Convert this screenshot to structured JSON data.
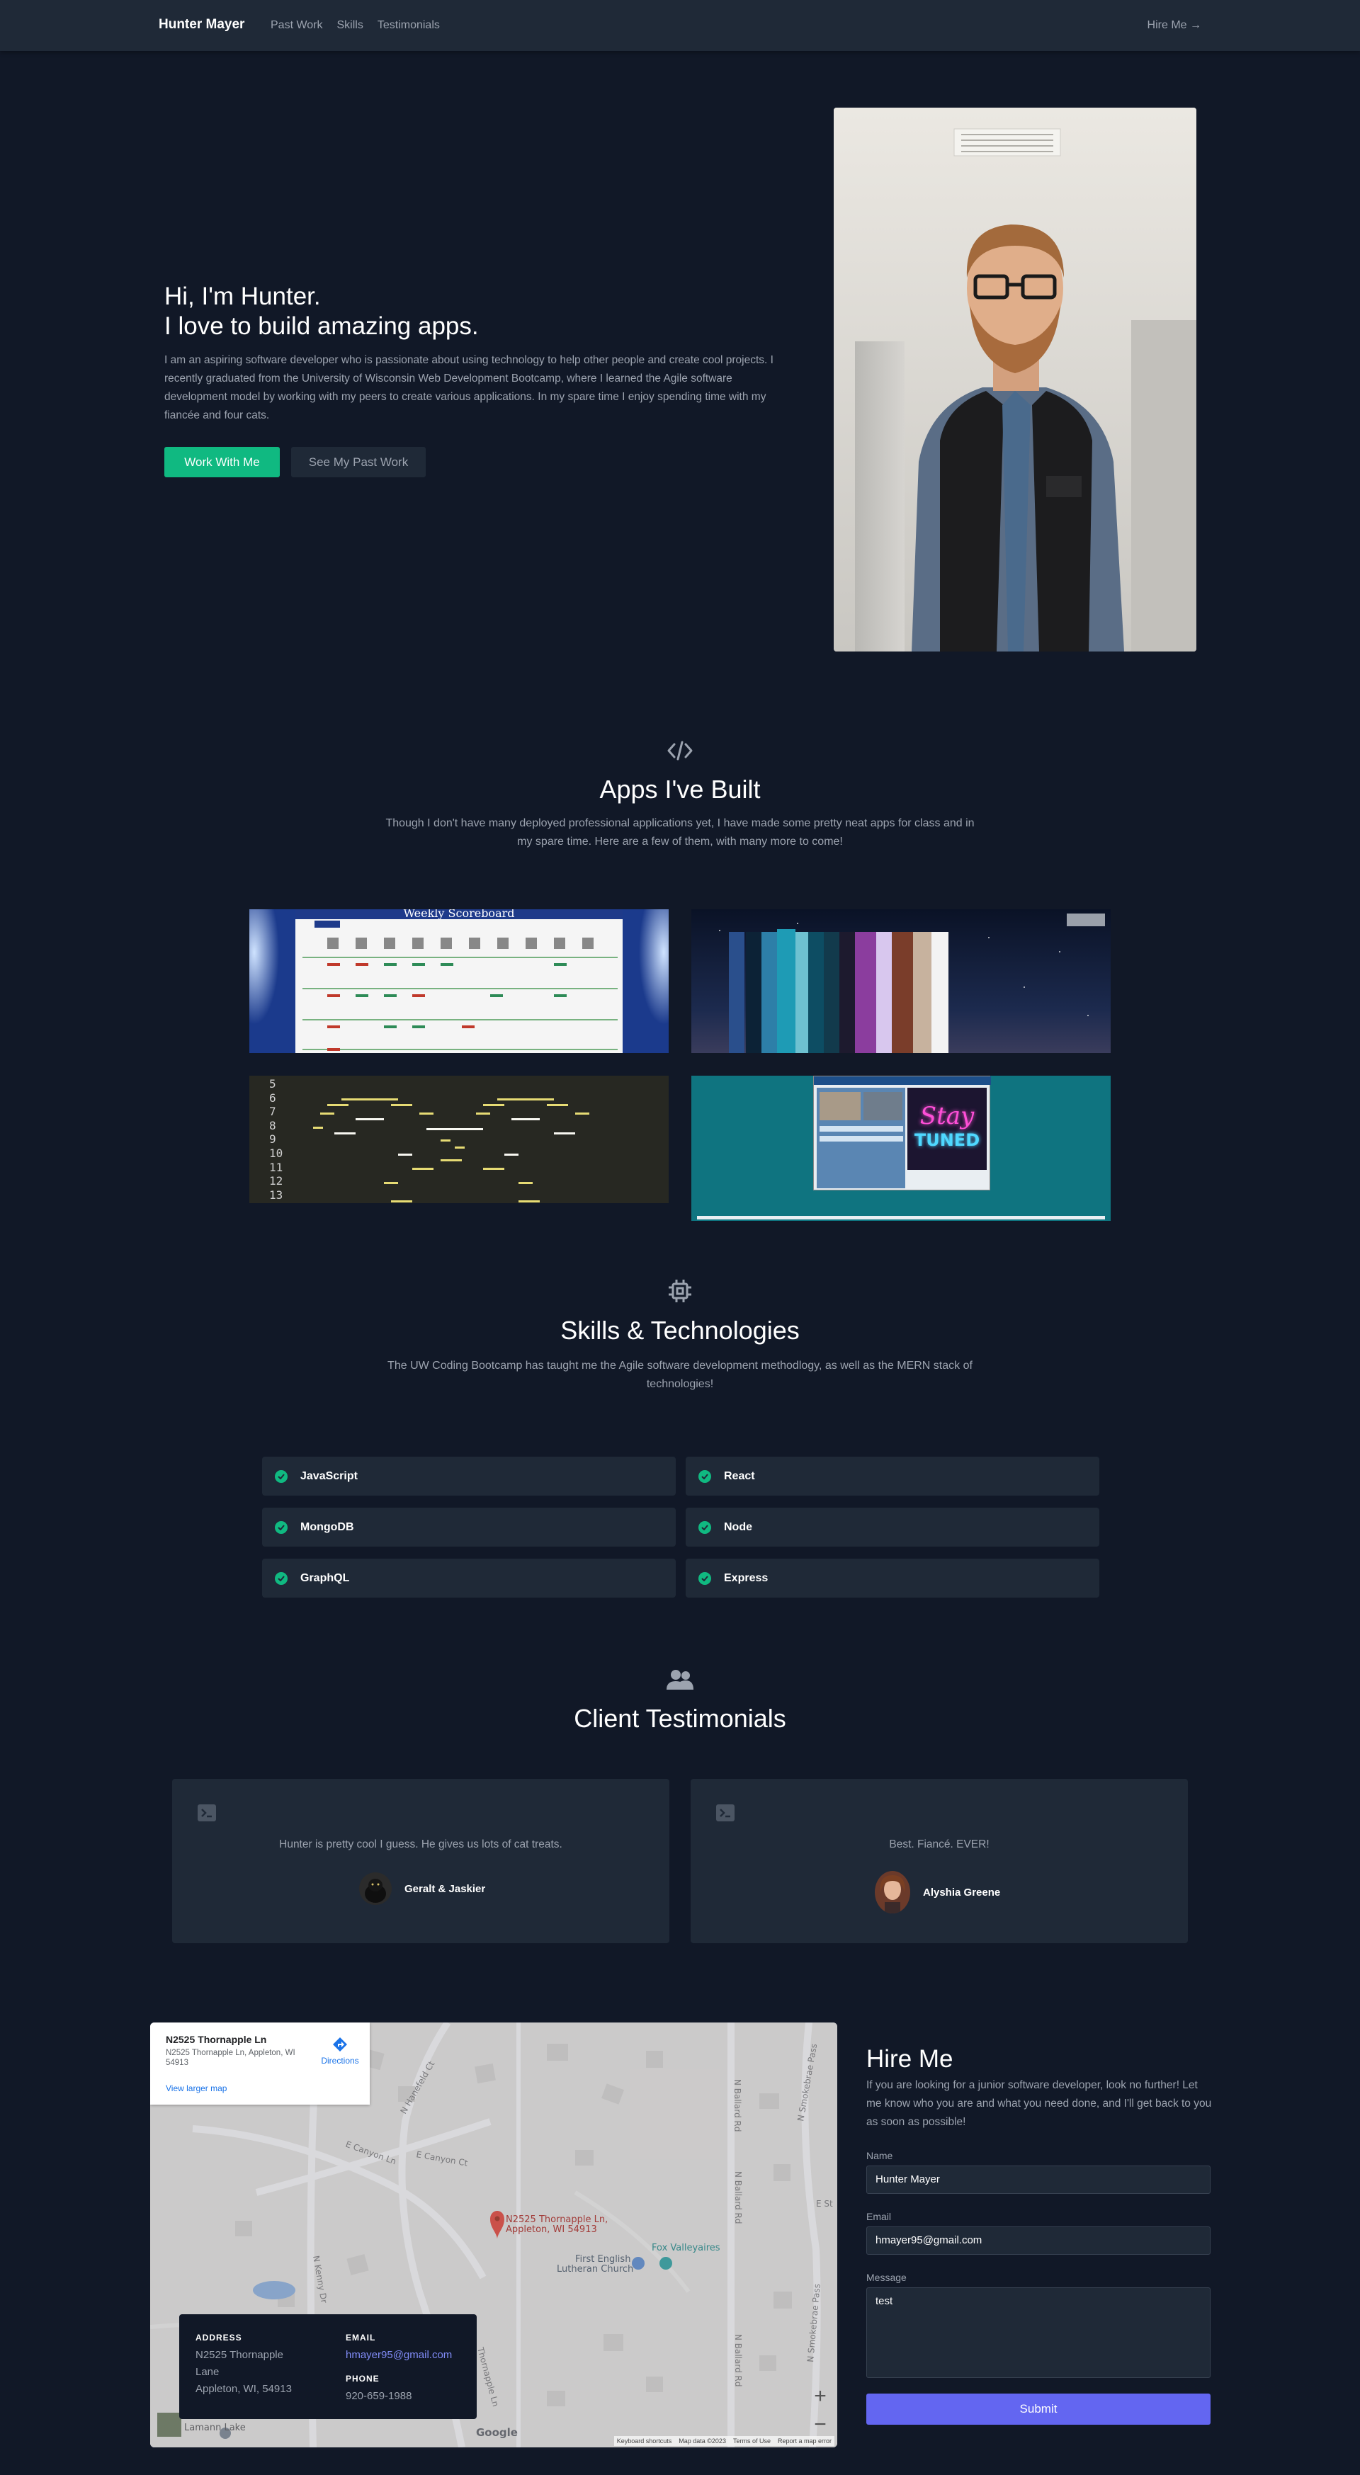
{
  "nav": {
    "brand": "Hunter Mayer",
    "links": [
      "Past Work",
      "Skills",
      "Testimonials"
    ],
    "hire": "Hire Me →"
  },
  "hero": {
    "line1": "Hi, I'm Hunter.",
    "line2": "I love to build amazing apps.",
    "text": "I am an aspiring software developer who is passionate about using technology to help other people and create cool projects. I recently graduated from the University of Wisconsin Web Development Bootcamp, where I learned the Agile software development model by working with my peers to create various applications. In my spare time I enjoy spending time with my fiancée and four cats.",
    "primary_button": "Work With Me",
    "secondary_button": "See My Past Work"
  },
  "projects": {
    "title": "Apps I've Built",
    "subtitle": "Though I don't have many deployed professional applications yet, I have made some pretty neat apps for class and in my spare time. Here are a few of them, with many more to come!",
    "scoreboard_title": "Weekly Scoreboard",
    "stay_tuned": [
      "Stay",
      "TUNED"
    ],
    "line_numbers": [
      "5",
      "6",
      "7",
      "8",
      "9",
      "10",
      "11",
      "12",
      "13"
    ]
  },
  "skills": {
    "title": "Skills & Technologies",
    "subtitle": "The UW Coding Bootcamp has taught me the Agile software development methodlogy, as well as the MERN stack of technologies!",
    "items": [
      "JavaScript",
      "React",
      "MongoDB",
      "Node",
      "GraphQL",
      "Express"
    ]
  },
  "testimonials": {
    "title": "Client Testimonials",
    "items": [
      {
        "quote": "Hunter is pretty cool I guess. He gives us lots of cat treats.",
        "author": "Geralt & Jaskier"
      },
      {
        "quote": "Best. Fiancé. EVER!",
        "author": "Alyshia Greene"
      }
    ]
  },
  "map": {
    "place_title": "N2525 Thornapple Ln",
    "place_address": "N2525 Thornapple Ln, Appleton, WI 54913",
    "directions": "Directions",
    "view_larger": "View larger map",
    "pin_label_1": "N2525 Thornapple Ln,",
    "pin_label_2": "Appleton, WI 54913",
    "poi_church_1": "First English",
    "poi_church_2": "Lutheran Church",
    "poi_fox": "Fox Valleyaires",
    "street_ballard_1": "N Ballard Rd",
    "street_ballard_2": "N Ballard Rd",
    "street_ballard_3": "N Ballard Rd",
    "street_smokebrae_1": "N Smokebrae Pass",
    "street_smokebrae_2": "N Smokebrae Pass",
    "street_canyon_ln": "E Canyon Ln",
    "street_canyon_ct": "E Canyon Ct",
    "street_hanefeld": "N Hanefeld Ct",
    "street_kenny": "N Kenny Dr",
    "street_thornapple": "Thornapple Ln",
    "street_e_st": "E St",
    "lake": "Lamann Lake",
    "google": "Google",
    "footer": [
      "Keyboard shortcuts",
      "Map data ©2023",
      "Terms of Use",
      "Report a map error"
    ],
    "zoom_in": "+",
    "zoom_out": "−"
  },
  "contact_info": {
    "address_label": "ADDRESS",
    "address_lines": [
      "N2525 Thornapple",
      "Lane",
      "Appleton, WI, 54913"
    ],
    "email_label": "EMAIL",
    "email": "hmayer95@gmail.com",
    "phone_label": "PHONE",
    "phone": "920-659-1988"
  },
  "form": {
    "title": "Hire Me",
    "text": "If you are looking for a junior software developer, look no further! Let me know who you are and what you need done, and I'll get back to you as soon as possible!",
    "name_label": "Name",
    "name_value": "Hunter Mayer",
    "email_label": "Email",
    "email_value": "hmayer95@gmail.com",
    "message_label": "Message",
    "message_value": "test",
    "submit": "Submit"
  },
  "colors": {
    "background": "#111827",
    "surface": "#1f2937",
    "accent_green": "#10b981",
    "accent_indigo": "#6366f1"
  }
}
